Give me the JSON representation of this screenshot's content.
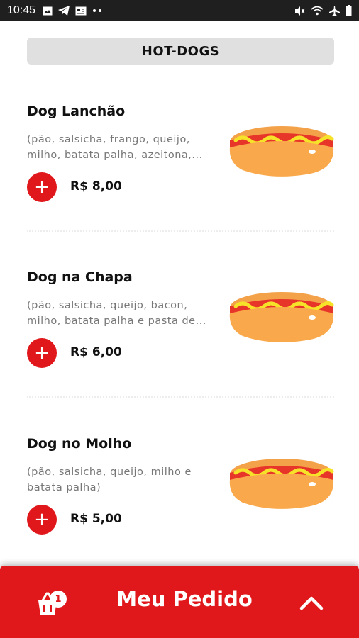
{
  "status_bar": {
    "time": "10:45",
    "left_icons": [
      "image-icon",
      "telegram-icon",
      "news-icon",
      "more-dots-icon"
    ],
    "right_icons": [
      "mute-icon",
      "wifi-icon",
      "airplane-icon",
      "battery-icon"
    ]
  },
  "section": {
    "title": "HOT-DOGS"
  },
  "items": [
    {
      "name": "Dog Lanchão",
      "description": "(pão, salsicha, frango, queijo, milho, batata palha, azeitona,...",
      "price": "R$ 8,00",
      "add_icon": "+"
    },
    {
      "name": "Dog na Chapa",
      "description": "(pão, salsicha, queijo, bacon, milho, batata palha e pasta de...",
      "price": "R$ 6,00",
      "add_icon": "+"
    },
    {
      "name": "Dog no Molho",
      "description": "(pão, salsicha, queijo, milho e batata palha)",
      "price": "R$ 5,00",
      "add_icon": "+"
    }
  ],
  "order_bar": {
    "title": "Meu Pedido",
    "cart_count": "1",
    "icon": "shopping-basket-icon",
    "expand_icon": "chevron-up-icon"
  },
  "colors": {
    "accent": "#e0171b",
    "status_bar": "#1f1f1f",
    "section_bg": "#e0e0e0"
  }
}
